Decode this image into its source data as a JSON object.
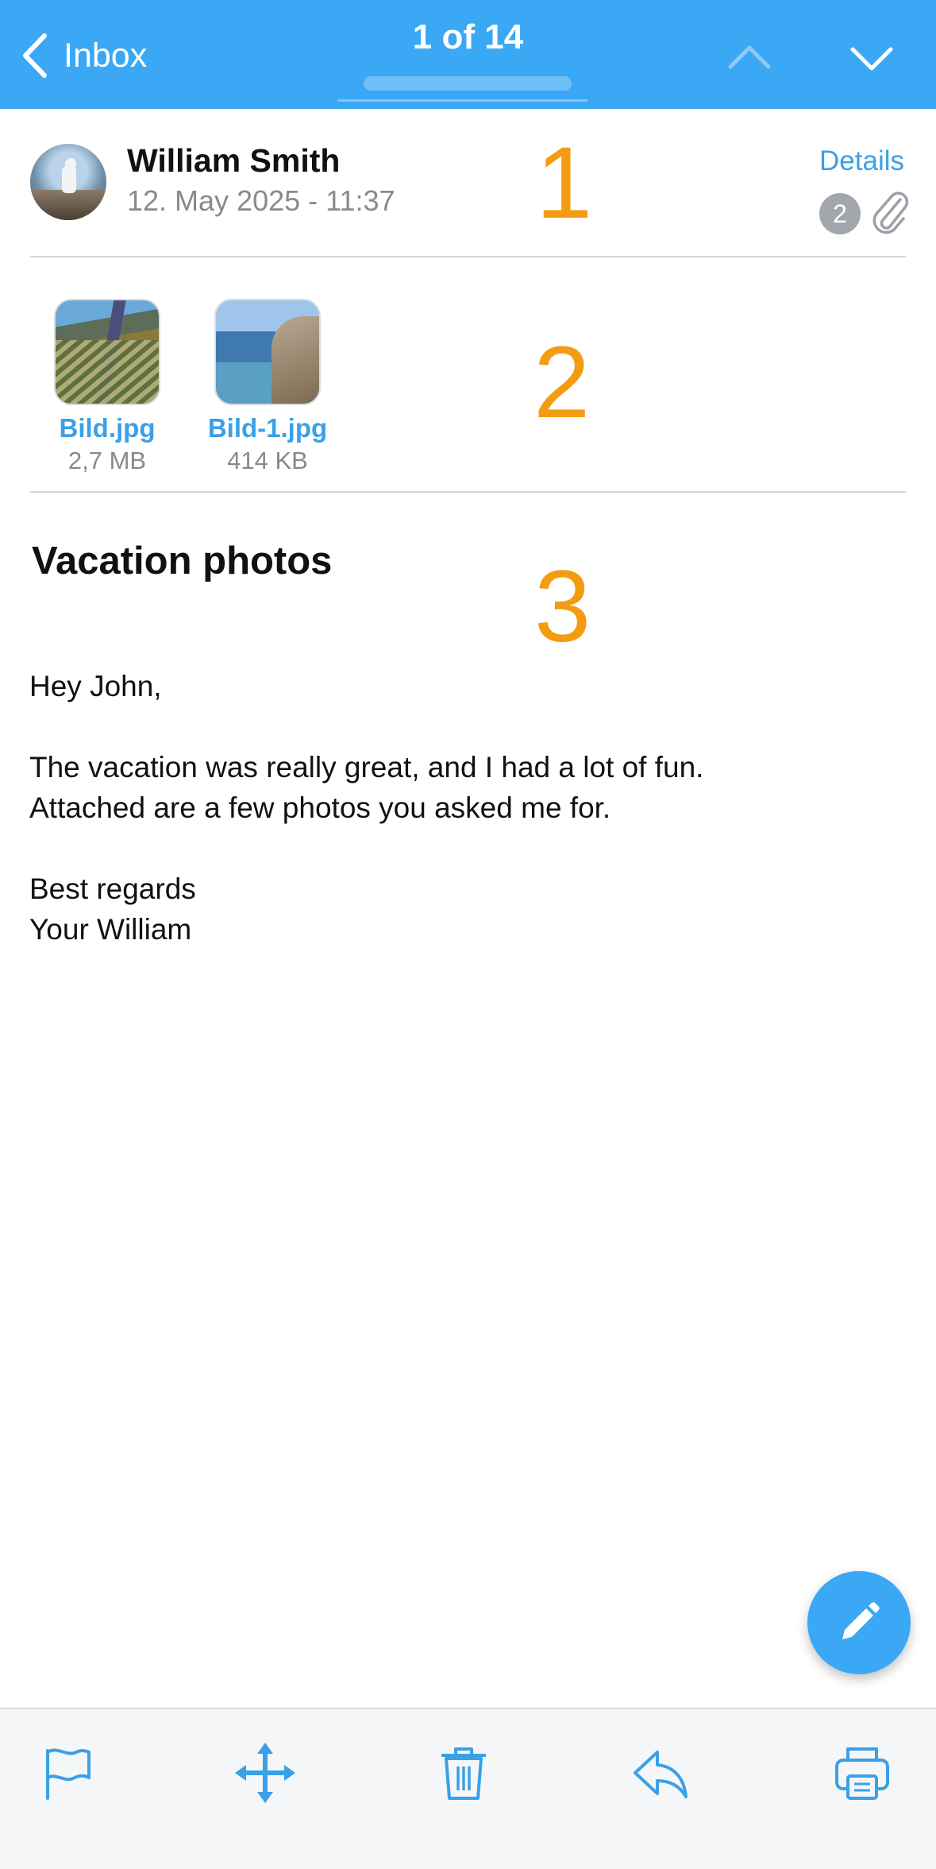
{
  "topbar": {
    "back_label": "Inbox",
    "counter": "1 of 14"
  },
  "header": {
    "sender": "William Smith",
    "date": "12. May 2025 - 11:37",
    "details_label": "Details",
    "attachment_count": "2"
  },
  "markers": [
    "1",
    "2",
    "3"
  ],
  "attachments": [
    {
      "name": "Bild.jpg",
      "size": "2,7 MB"
    },
    {
      "name": "Bild-1.jpg",
      "size": "414 KB"
    }
  ],
  "message": {
    "subject": "Vacation photos",
    "greeting": "Hey John,",
    "line1": "The vacation was really great, and I had a lot of fun.",
    "line2": "Attached are a few photos you asked me for.",
    "closing": "Best regards",
    "signature": "Your William"
  },
  "colors": {
    "accent": "#3aa8f5",
    "link": "#3aa0e8",
    "marker": "#f39c12"
  },
  "icons": {
    "topbar": [
      "chevron-left-icon",
      "chevron-up-icon",
      "chevron-down-icon"
    ],
    "header": [
      "paperclip-icon"
    ],
    "fab": "pencil-icon",
    "toolbar": [
      "flag-icon",
      "move-icon",
      "trash-icon",
      "reply-icon",
      "print-icon"
    ]
  }
}
